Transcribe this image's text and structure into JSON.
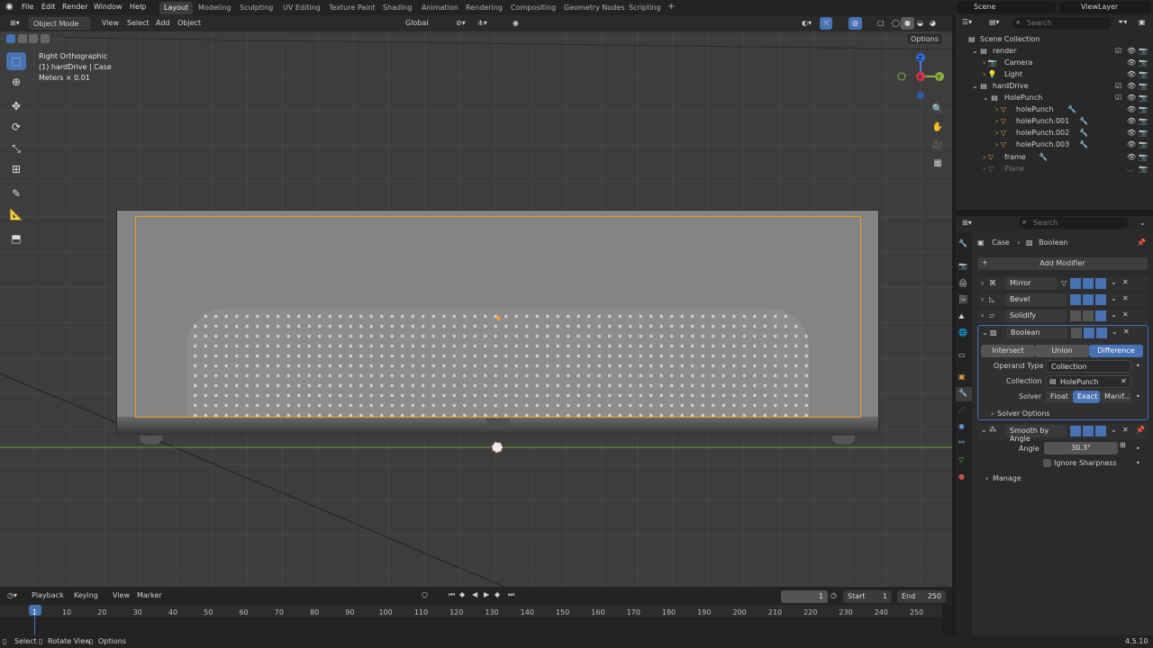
{
  "menus": [
    "File",
    "Edit",
    "Render",
    "Window",
    "Help"
  ],
  "workspaces": [
    "Layout",
    "Modeling",
    "Sculpting",
    "UV Editing",
    "Texture Paint",
    "Shading",
    "Animation",
    "Rendering",
    "Compositing",
    "Geometry Nodes",
    "Scripting"
  ],
  "add_tab": "+",
  "scene": "Scene",
  "view_layer": "ViewLayer",
  "vp_header": {
    "mode": "Object Mode",
    "view": "View",
    "select": "Select",
    "add": "Add",
    "object": "Object",
    "orientation": "Global",
    "options": "Options"
  },
  "vp_info": {
    "view_name": "Right Orthographic",
    "object": "(1) hardDrive | Case",
    "units": "Meters × 0.01"
  },
  "gizmo": {
    "x": "X",
    "y": "Y",
    "z": "Z"
  },
  "outliner": {
    "search_placeholder": "Search",
    "rows": [
      {
        "label": "Scene Collection"
      },
      {
        "label": "render"
      },
      {
        "label": "Camera"
      },
      {
        "label": "Light"
      },
      {
        "label": "hardDrive"
      },
      {
        "label": "HolePunch"
      },
      {
        "label": "holePunch"
      },
      {
        "label": "holePunch.001"
      },
      {
        "label": "holePunch.002"
      },
      {
        "label": "holePunch.003"
      },
      {
        "label": "frame"
      },
      {
        "label": "Plane"
      }
    ]
  },
  "props": {
    "search_placeholder": "Search",
    "breadcrumb_object": "Case",
    "breadcrumb_mod": "Boolean",
    "add_modifier": "Add Modifier",
    "modifiers": [
      "Mirror",
      "Bevel",
      "Solidify",
      "Boolean",
      "Smooth by Angle"
    ],
    "ops": [
      "Intersect",
      "Union",
      "Difference"
    ],
    "operand_type_label": "Operand Type",
    "operand_type": "Collection",
    "collection_label": "Collection",
    "collection": "HolePunch",
    "solver_label": "Solver",
    "solvers": [
      "Float",
      "Exact",
      "Manif..."
    ],
    "solver_options": "Solver Options",
    "angle_label": "Angle",
    "angle": "30.3°",
    "ignore_sharpness": "Ignore Sharpness",
    "manage": "Manage"
  },
  "timeline": {
    "playback": "Playback",
    "keying": "Keying",
    "view": "View",
    "marker": "Marker",
    "current": "1",
    "start_label": "Start",
    "start": "1",
    "end_label": "End",
    "end": "250",
    "frames": [
      "1",
      "10",
      "20",
      "30",
      "40",
      "50",
      "60",
      "70",
      "80",
      "90",
      "100",
      "110",
      "120",
      "130",
      "140",
      "150",
      "160",
      "170",
      "180",
      "190",
      "200",
      "210",
      "220",
      "230",
      "240",
      "250"
    ]
  },
  "status": {
    "select": "Select",
    "rotate": "Rotate View",
    "options": "Options",
    "version": "4.5.10"
  }
}
